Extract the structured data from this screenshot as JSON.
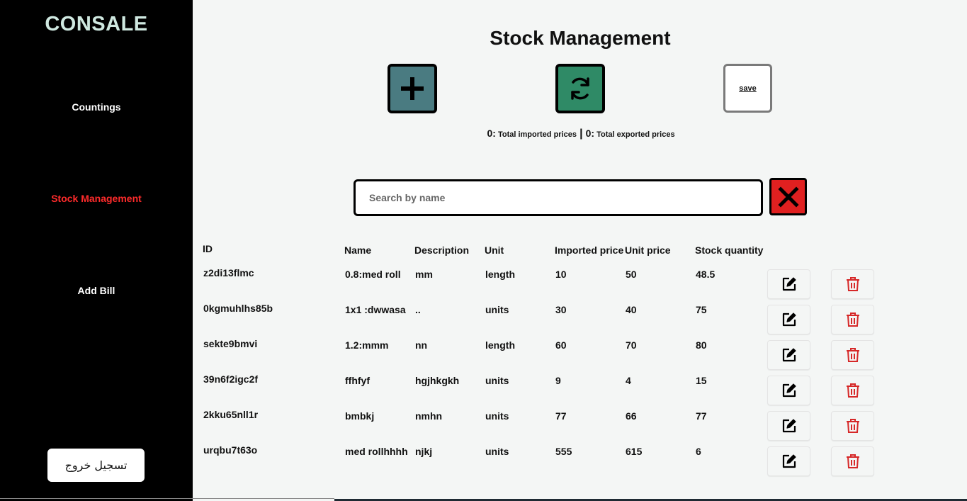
{
  "sidebar": {
    "brand": "CONSALE",
    "items": [
      {
        "label": "Countings",
        "active": false
      },
      {
        "label": "Stock Management",
        "active": true
      },
      {
        "label": "Add Bill",
        "active": false
      }
    ],
    "logout_label": "تسجيل خروج"
  },
  "header": {
    "title": "Stock Management",
    "save_label": "save"
  },
  "totals": {
    "imported_value": "0:",
    "imported_label": "Total imported prices",
    "separator": "|",
    "exported_value": "0:",
    "exported_label": "Total exported prices"
  },
  "search": {
    "placeholder": "Search by name",
    "value": ""
  },
  "table": {
    "headers": {
      "id": "ID",
      "name": "Name",
      "description": "Description",
      "unit": "Unit",
      "imported_price": "Imported price",
      "unit_price": "Unit price",
      "stock_quantity": "Stock quantity"
    },
    "rows": [
      {
        "id": "z2di13flmc",
        "name": "0.8:med roll",
        "description": "mm",
        "unit": "length",
        "imported_price": "10",
        "unit_price": "50",
        "stock_quantity": "48.5"
      },
      {
        "id": "0kgmuhlhs85b",
        "name": "1x1 :dwwasa",
        "description": "..",
        "unit": "units",
        "imported_price": "30",
        "unit_price": "40",
        "stock_quantity": "75"
      },
      {
        "id": "sekte9bmvi",
        "name": "1.2:mmm",
        "description": "nn",
        "unit": "length",
        "imported_price": "60",
        "unit_price": "70",
        "stock_quantity": "80"
      },
      {
        "id": "39n6f2igc2f",
        "name": "ffhfyf",
        "description": "hgjhkgkh",
        "unit": "units",
        "imported_price": "9",
        "unit_price": "4",
        "stock_quantity": "15"
      },
      {
        "id": "2kku65nll1r",
        "name": "bmbkj",
        "description": "nmhn",
        "unit": "units",
        "imported_price": "77",
        "unit_price": "66",
        "stock_quantity": "77"
      },
      {
        "id": "urqbu7t63o",
        "name": "med rollhhhh",
        "description": "njkj",
        "unit": "units",
        "imported_price": "555",
        "unit_price": "615",
        "stock_quantity": "6"
      }
    ]
  },
  "colors": {
    "sidebar_bg": "#000000",
    "active_nav": "#ff2b2b",
    "brand": "#cfe8e0",
    "add_button": "#4a7b81",
    "refresh_button": "#2f8a66",
    "clear_button": "#e02020",
    "delete_icon": "#d62828"
  },
  "icons": {
    "add": "plus-icon",
    "refresh": "refresh-icon",
    "clear": "close-icon",
    "edit": "edit-icon",
    "delete": "trash-icon"
  }
}
